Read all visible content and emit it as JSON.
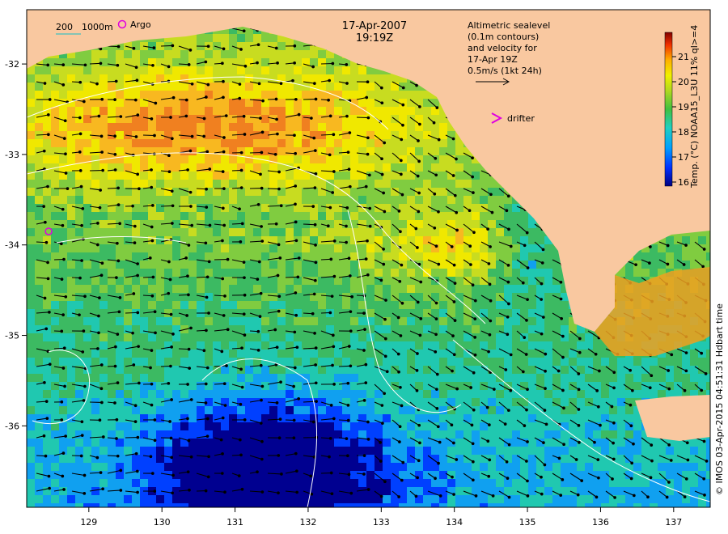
{
  "header": {
    "date": "17-Apr-2007",
    "time": "19:19Z"
  },
  "legend_depth": {
    "label_a": "200",
    "label_b": "1000m"
  },
  "legend_argo": {
    "label": "Argo"
  },
  "legend_drifter": {
    "label": "drifter"
  },
  "altimetry_note": {
    "lines": [
      "Altimetric sealevel",
      "(0.1m contours)",
      "and velocity for",
      "17-Apr 19Z",
      "0.5m/s (1kt 24h)"
    ]
  },
  "colorbar": {
    "label": "Temp. (°C) NOAA15_L3U 11% ql>=4",
    "ticks": [
      "21",
      "20",
      "19",
      "18",
      "17",
      "16"
    ],
    "colors": [
      "#000080",
      "#0000ff",
      "#0080ff",
      "#00c8ff",
      "#30d0a0",
      "#40c040",
      "#a0d020",
      "#f0f000",
      "#ffb000",
      "#ff6000",
      "#e00000",
      "#800000"
    ]
  },
  "credit": "© IMOS 03-Apr-2015 04:51:31 Hdbart time",
  "axes": {
    "x_ticks": [
      "129",
      "130",
      "131",
      "132",
      "133",
      "134",
      "135",
      "136",
      "137"
    ],
    "y_ticks": [
      "-32",
      "-33",
      "-34",
      "-35",
      "-36"
    ]
  },
  "colors": {
    "land": "#f9c8a0",
    "warm": "#f0a020",
    "mid": "#9ed040",
    "cool": "#28b868",
    "cold": "#2090e0",
    "arrow": "#000000",
    "contour": "#ffffff",
    "argo_marker": "#e000e0"
  },
  "map_data": {
    "lon_range": [
      128.15,
      137.5
    ],
    "lat_range": [
      -36.9,
      -31.4
    ],
    "argo_float": {
      "lon": 128.45,
      "lat": -33.85
    }
  }
}
